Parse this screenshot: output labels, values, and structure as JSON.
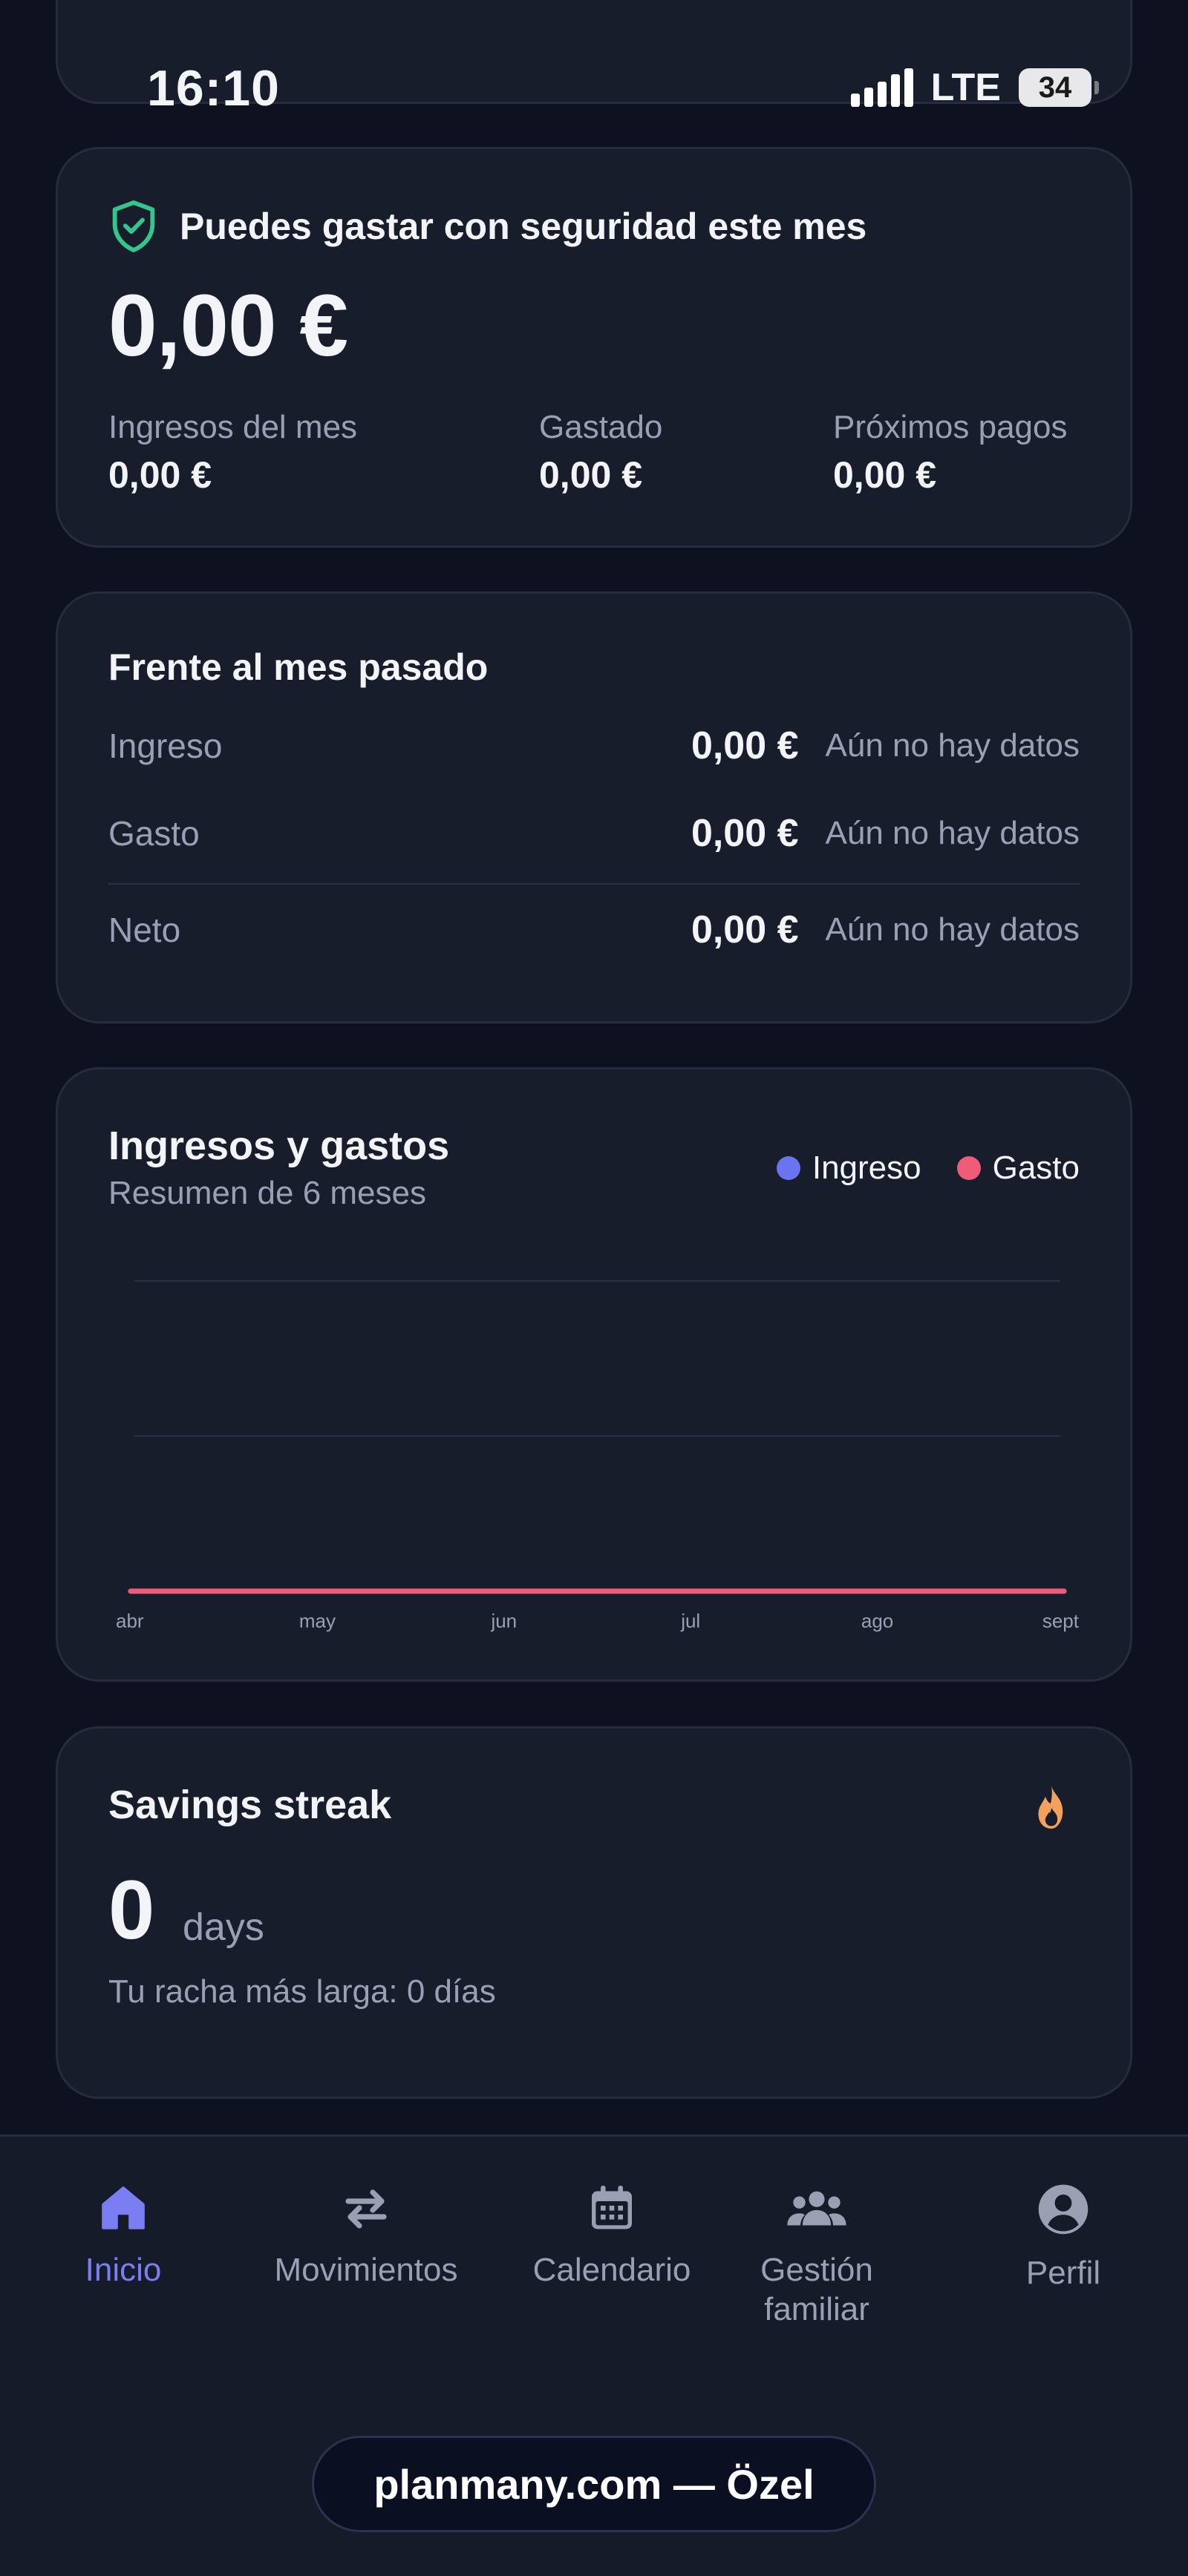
{
  "status_bar": {
    "time": "16:10",
    "network": "LTE",
    "battery": "34"
  },
  "safe_spend": {
    "title": "Puedes gastar con seguridad este mes",
    "amount": "0,00 €",
    "stats": [
      {
        "label": "Ingresos del mes",
        "value": "0,00 €"
      },
      {
        "label": "Gastado",
        "value": "0,00 €"
      },
      {
        "label": "Próximos pagos",
        "value": "0,00 €"
      }
    ]
  },
  "comparison": {
    "title": "Frente al mes pasado",
    "rows": [
      {
        "label": "Ingreso",
        "value": "0,00 €",
        "status": "Aún no hay datos"
      },
      {
        "label": "Gasto",
        "value": "0,00 €",
        "status": "Aún no hay datos"
      },
      {
        "label": "Neto",
        "value": "0,00 €",
        "status": "Aún no hay datos"
      }
    ]
  },
  "chart_card": {
    "title": "Ingresos y gastos",
    "subtitle": "Resumen de 6 meses",
    "legend": [
      {
        "name": "Ingreso",
        "color": "#6b74f0"
      },
      {
        "name": "Gasto",
        "color": "#ef5c7a"
      }
    ]
  },
  "chart_data": {
    "type": "line",
    "categories": [
      "abr",
      "may",
      "jun",
      "jul",
      "ago",
      "sept"
    ],
    "series": [
      {
        "name": "Ingreso",
        "values": [
          0,
          0,
          0,
          0,
          0,
          0
        ]
      },
      {
        "name": "Gasto",
        "values": [
          0,
          0,
          0,
          0,
          0,
          0
        ]
      }
    ],
    "ylim": [
      0,
      1
    ],
    "grid": true
  },
  "streak": {
    "title": "Savings streak",
    "count": "0",
    "unit": "days",
    "longest": "Tu racha más larga: 0 días",
    "icon": "flame-icon"
  },
  "nav": {
    "items": [
      {
        "label": "Inicio",
        "icon": "home-icon",
        "active": true
      },
      {
        "label": "Movimientos",
        "icon": "transfer-icon",
        "active": false
      },
      {
        "label": "Calendario",
        "icon": "calendar-icon",
        "active": false
      },
      {
        "label": "Gestión familiar",
        "icon": "family-icon",
        "active": false
      },
      {
        "label": "Perfil",
        "icon": "profile-icon",
        "active": false
      }
    ]
  },
  "url_bar": {
    "text": "planmany.com — Özel"
  }
}
